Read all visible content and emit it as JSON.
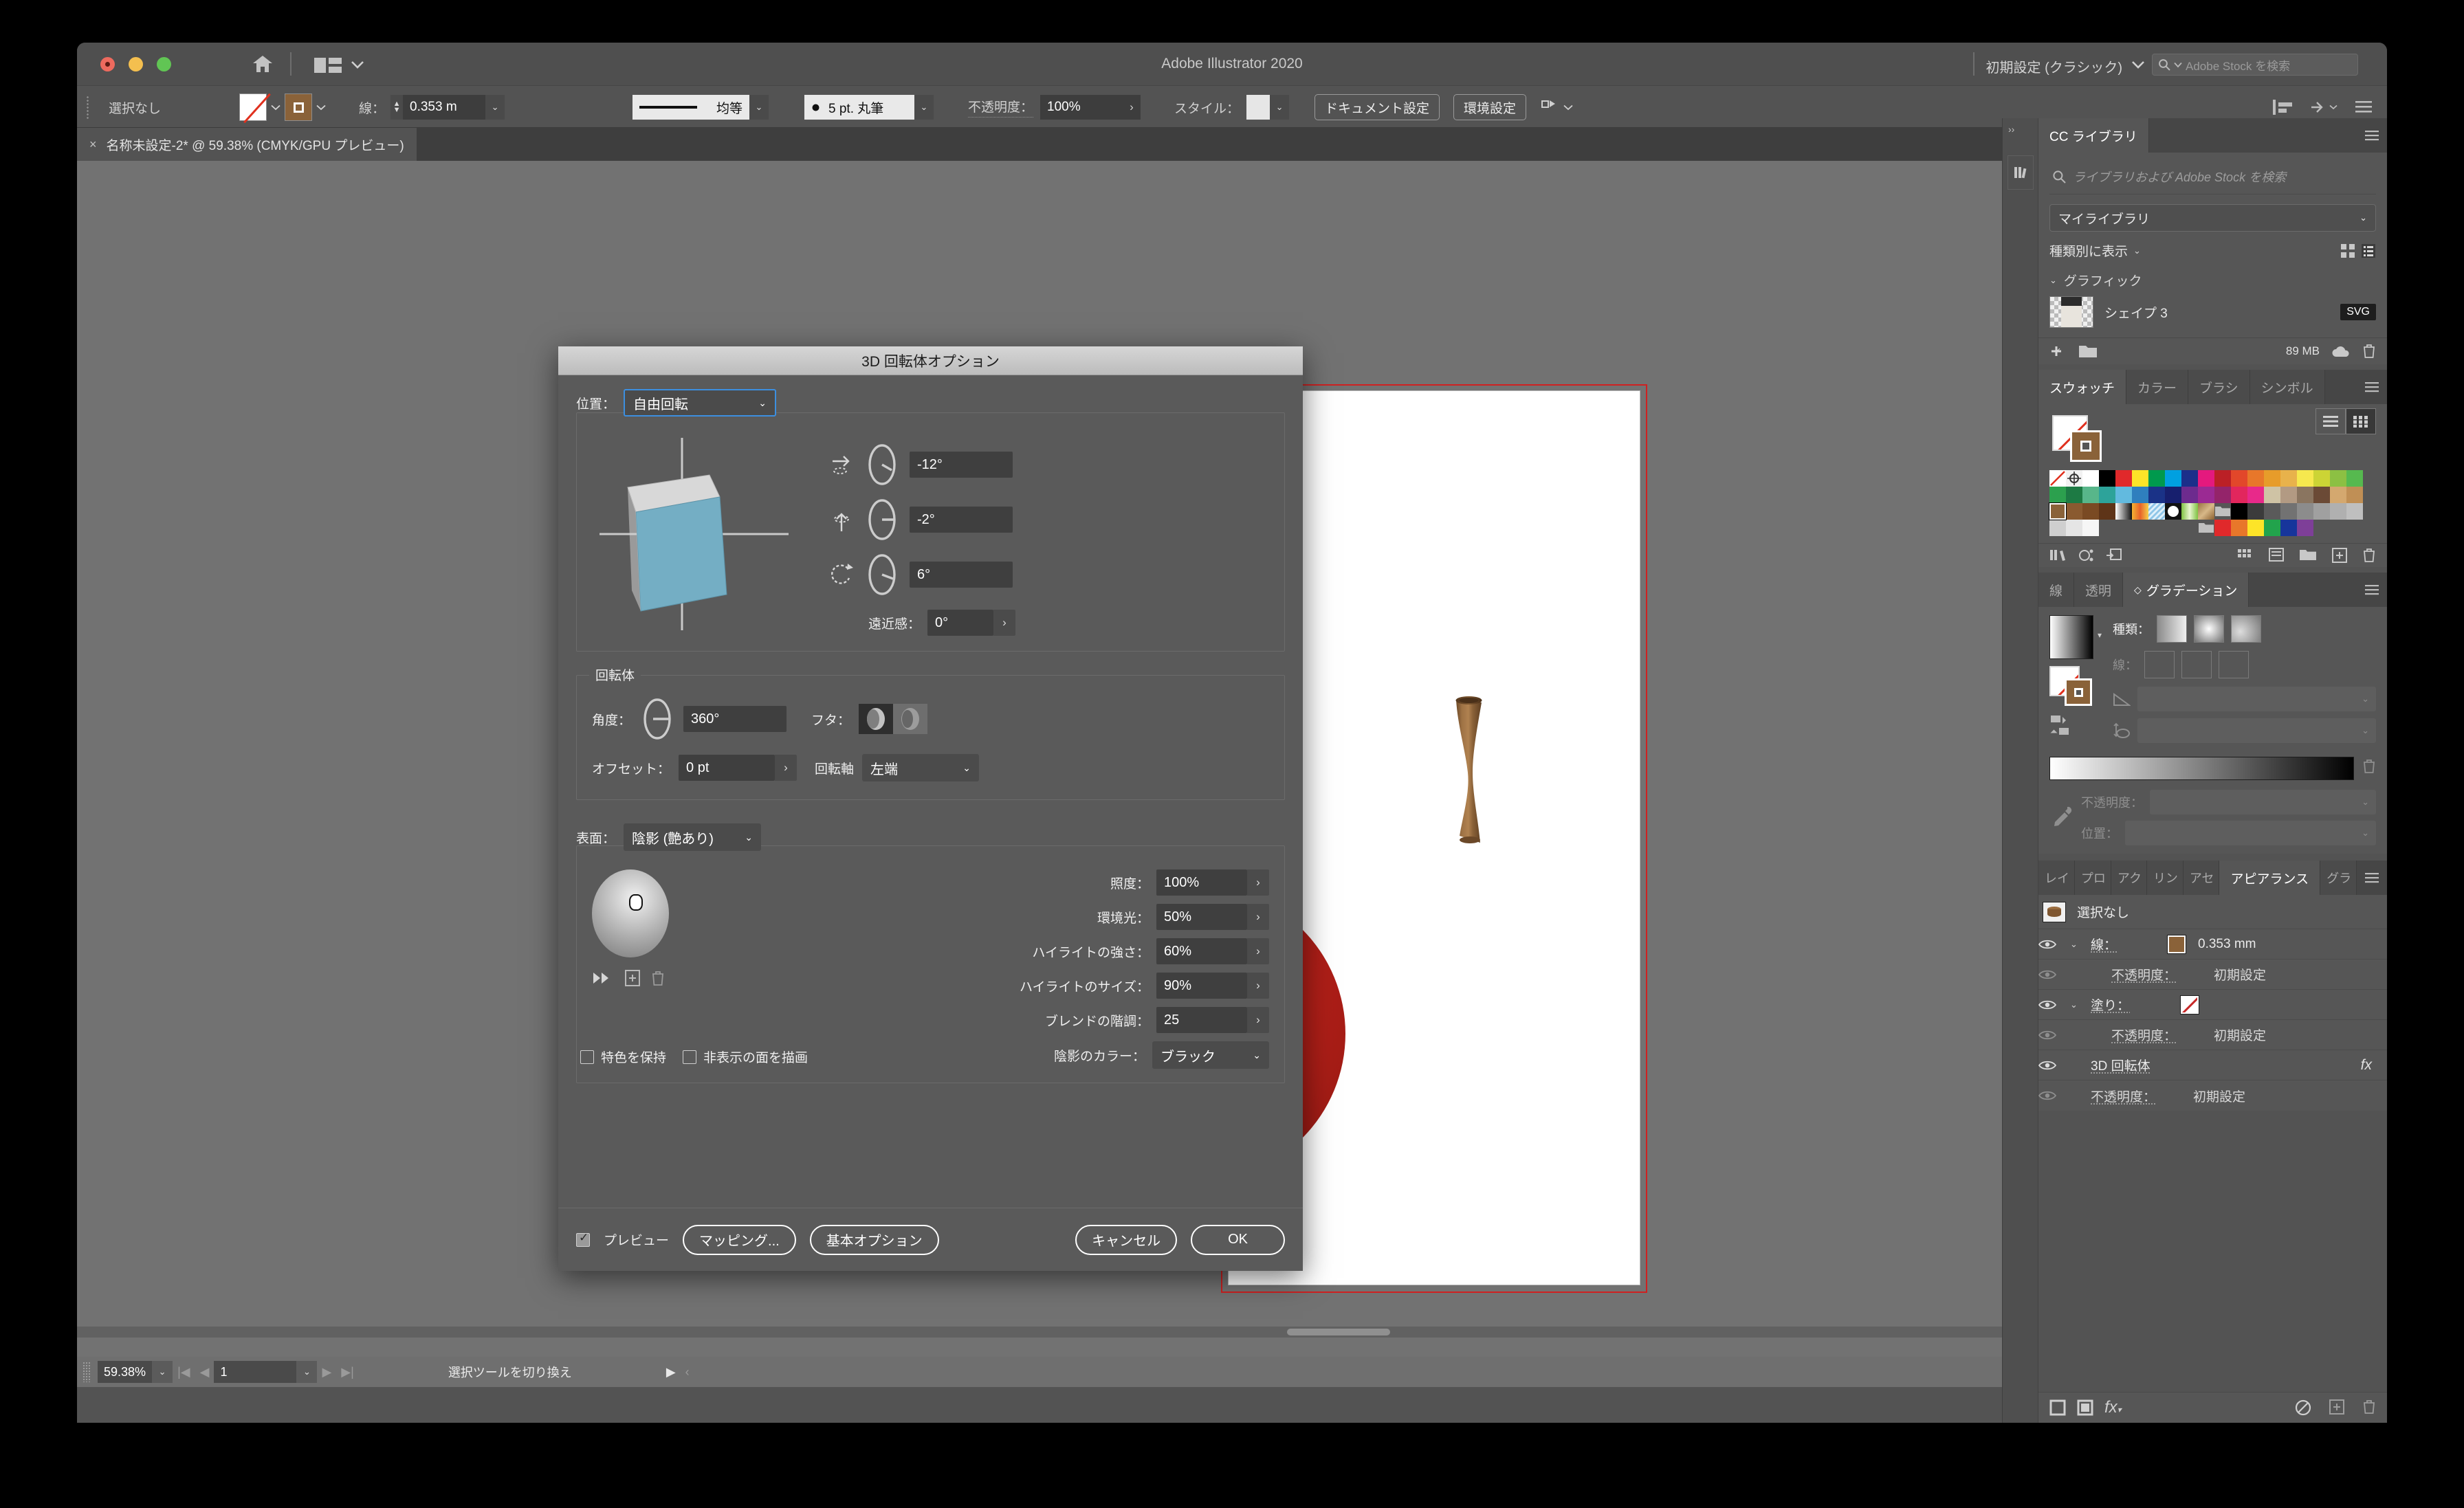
{
  "window": {
    "app_title": "Adobe Illustrator 2020",
    "workspace": "初期設定 (クラシック)",
    "stock_search_placeholder": "Adobe Stock を検索"
  },
  "control_bar": {
    "selection_label": "選択なし",
    "stroke_label": "線：",
    "stroke_weight": "0.353 m",
    "stroke_profile": "均等",
    "brush": "5 pt. 丸筆",
    "opacity_label": "不透明度：",
    "opacity_value": "100%",
    "style_label": "スタイル：",
    "document_setup": "ドキュメント設定",
    "preferences": "環境設定"
  },
  "document_tab": {
    "close": "×",
    "title": "名称未設定-2* @ 59.38% (CMYK/GPU プレビュー)"
  },
  "status_bar": {
    "zoom": "59.38%",
    "page": "1",
    "message": "選択ツールを切り換え"
  },
  "dialog": {
    "title": "3D 回転体オプション",
    "position_label": "位置：",
    "position_value": "自由回転",
    "rotate_x": "-12°",
    "rotate_y": "-2°",
    "rotate_z": "6°",
    "perspective_label": "遠近感：",
    "perspective_value": "0°",
    "revolve_group": "回転体",
    "angle_label": "角度：",
    "angle_value": "360°",
    "cap_label": "フタ：",
    "offset_label": "オフセット：",
    "offset_value": "0 pt",
    "axis_label": "回転軸",
    "axis_value": "左端",
    "surface_label": "表面：",
    "surface_value": "陰影 (艶あり)",
    "light_intensity_label": "照度：",
    "light_intensity_value": "100%",
    "ambient_label": "環境光：",
    "ambient_value": "50%",
    "highlight_intensity_label": "ハイライトの強さ：",
    "highlight_intensity_value": "60%",
    "highlight_size_label": "ハイライトのサイズ：",
    "highlight_size_value": "90%",
    "blend_steps_label": "ブレンドの階調：",
    "blend_steps_value": "25",
    "shading_color_label": "陰影のカラー：",
    "shading_color_value": "ブラック",
    "preserve_spot_label": "特色を保持",
    "draw_hidden_label": "非表示の面を描画",
    "preview_label": "プレビュー",
    "map_button": "マッピング...",
    "basic_options_button": "基本オプション",
    "cancel_button": "キャンセル",
    "ok_button": "OK"
  },
  "cc_libraries": {
    "tab": "CC ライブラリ",
    "search_placeholder": "ライブラリおよび Adobe Stock を検索",
    "library_select": "マイライブラリ",
    "view_by": "種類別に表示",
    "section": "グラフィック",
    "item_name": "シェイプ 3",
    "item_badge": "SVG",
    "size": "89 MB"
  },
  "swatches_panel": {
    "tabs": [
      "スウォッチ",
      "カラー",
      "ブラシ",
      "シンボル"
    ],
    "active_tab": "スウォッチ",
    "row1": [
      "none",
      "registration",
      "#ffffff",
      "#000000",
      "#e0292b",
      "#fde428",
      "#00994d",
      "#00a0e0",
      "#1b2f8a",
      "#e4197e",
      "#bb2026",
      "#e2472a",
      "#e8772a",
      "#e79c2a",
      "#e8b24b",
      "#f6e84e",
      "#ccd435",
      "#8cc043"
    ],
    "row2": [
      "#56b94f",
      "#2ca04e",
      "#1d7a44",
      "#58b68a",
      "#2da39a",
      "#62badf",
      "#2f7fbe",
      "#1a3287",
      "#171f6e",
      "#6d2b8e",
      "#9b2a93",
      "#94246a",
      "#e2265d",
      "#e8298a",
      "#cfc3a5",
      "#b29a83",
      "#8a7560",
      "#6b4a36"
    ],
    "row3": [
      "#d4a86f",
      "#c08f55",
      "#8a6239",
      "#8a5a30",
      "#7a4a23",
      "#5e3418",
      "gradient-bw",
      "gradient-warm",
      "pattern-sky",
      "pattern-dot",
      "pattern-leaf",
      "pattern-scroll"
    ],
    "row4": [
      "folder",
      "#000000",
      "#3b3b3b",
      "#5a5a5a",
      "#727272",
      "#8c8c8c",
      "#a0a0a0",
      "#b0b0b0",
      "#bfbfbf",
      "#cfcfcf",
      "#e5e5e5",
      "#f6f6f6"
    ],
    "row5": [
      "folder",
      "#e0292b",
      "#e8772a",
      "#fde428",
      "#22a34c",
      "#17359b",
      "#7e3f98"
    ]
  },
  "gradient_panel": {
    "tabs": [
      "線",
      "透明",
      "グラデーション"
    ],
    "active_tab": "グラデーション",
    "type_label": "種類：",
    "stroke_label": "線：",
    "opacity_label": "不透明度：",
    "location_label": "位置："
  },
  "appearance_panel": {
    "tabs": [
      "レイ",
      "プロ",
      "アク",
      "リン",
      "アセ",
      "アピアランス",
      "グラ"
    ],
    "active_tab": "アピアランス",
    "target": "選択なし",
    "rows": [
      {
        "label": "線：",
        "value": "0.353 mm",
        "swatch": "#8a6239",
        "type": "stroke"
      },
      {
        "label": "不透明度：",
        "value": "初期設定",
        "type": "opacity"
      },
      {
        "label": "塗り：",
        "value": "",
        "swatch": "none",
        "type": "fill"
      },
      {
        "label": "不透明度：",
        "value": "初期設定",
        "type": "opacity"
      },
      {
        "label": "3D 回転体",
        "value": "",
        "type": "effect"
      },
      {
        "label": "不透明度：",
        "value": "初期設定",
        "type": "opacity"
      }
    ]
  },
  "colors": {
    "app_bg": "#535353",
    "panel_bg": "#565656",
    "dialog_bg": "#5a5a5a",
    "accent_blue": "#3c8fe0",
    "artboard_border": "#cf2020",
    "vase_brown": "#8a6239",
    "circle_red": "#b21f18"
  }
}
